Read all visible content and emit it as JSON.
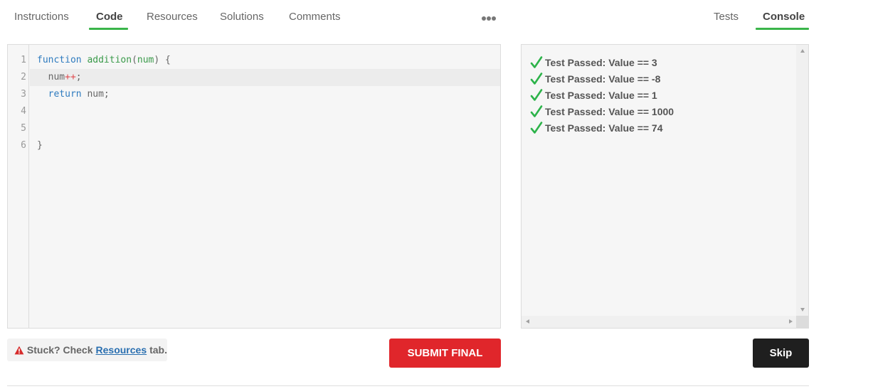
{
  "tabs_left": [
    {
      "label": "Instructions",
      "active": false
    },
    {
      "label": "Code",
      "active": true
    },
    {
      "label": "Resources",
      "active": false
    },
    {
      "label": "Solutions",
      "active": false
    },
    {
      "label": "Comments",
      "active": false
    }
  ],
  "tabs_right": [
    {
      "label": "Tests",
      "active": false
    },
    {
      "label": "Console",
      "active": true
    }
  ],
  "more_menu_icon": "more-dots-icon",
  "editor": {
    "line_numbers": [
      "1",
      "2",
      "3",
      "4",
      "5",
      "6"
    ],
    "lines": [
      {
        "tokens": [
          {
            "t": "function",
            "c": "kw"
          },
          {
            "t": " ",
            "c": "punc"
          },
          {
            "t": "addition",
            "c": "fn"
          },
          {
            "t": "(",
            "c": "punc"
          },
          {
            "t": "num",
            "c": "fn"
          },
          {
            "t": ") {",
            "c": "punc"
          }
        ]
      },
      {
        "tokens": [
          {
            "t": "  num",
            "c": "punc"
          },
          {
            "t": "++",
            "c": "op"
          },
          {
            "t": ";",
            "c": "punc"
          }
        ]
      },
      {
        "tokens": [
          {
            "t": "  ",
            "c": "punc"
          },
          {
            "t": "return",
            "c": "kw"
          },
          {
            "t": " num;",
            "c": "punc"
          }
        ]
      },
      {
        "tokens": []
      },
      {
        "tokens": []
      },
      {
        "tokens": [
          {
            "t": "}",
            "c": "punc"
          }
        ]
      }
    ],
    "highlighted_line": 2
  },
  "console": {
    "results": [
      "Test Passed: Value == 3",
      "Test Passed: Value == -8",
      "Test Passed: Value == 1",
      "Test Passed: Value == 1000",
      "Test Passed: Value == 74"
    ],
    "check_color": "#2db34a"
  },
  "hint": {
    "prefix": "Stuck? Check",
    "link": "Resources",
    "suffix": "tab.",
    "icon": "warning-icon",
    "icon_color": "#d62b2b"
  },
  "buttons": {
    "submit_label": "SUBMIT FINAL",
    "skip_label": "Skip"
  },
  "colors": {
    "active_tab_underline": "#3ab54a",
    "submit_bg": "#e0262b",
    "skip_bg": "#1f1f1f"
  }
}
